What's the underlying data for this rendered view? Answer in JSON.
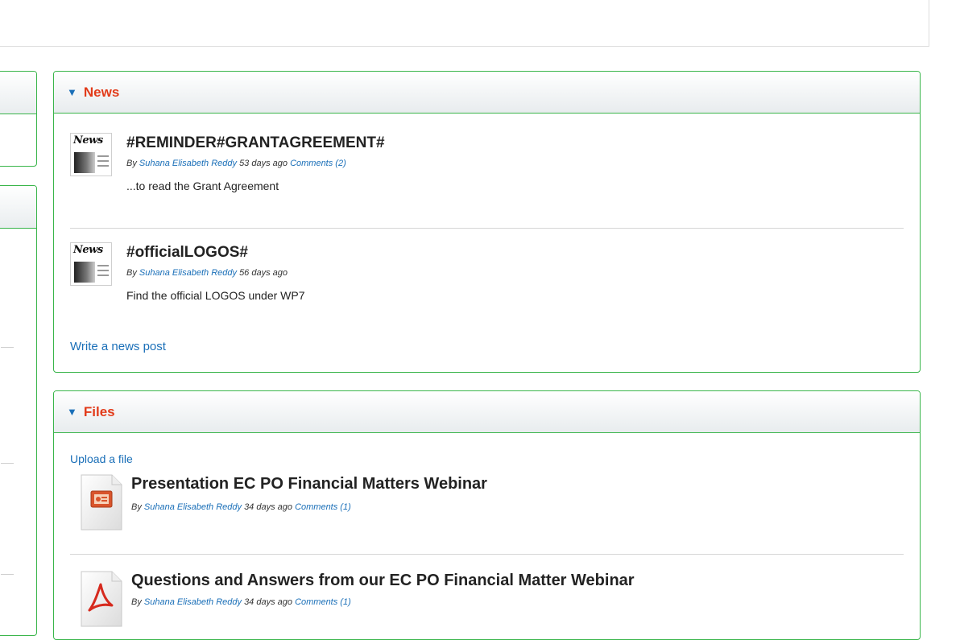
{
  "news": {
    "title": "News",
    "items": [
      {
        "title": "#REMINDER#GRANTAGREEMENT#",
        "by_prefix": "By",
        "author": "Suhana Elisabeth Reddy",
        "age": "53 days ago",
        "comments": "Comments (2)",
        "excerpt": "...to read the Grant Agreement"
      },
      {
        "title": "#officialLOGOS#",
        "by_prefix": "By",
        "author": "Suhana Elisabeth Reddy",
        "age": "56 days ago",
        "comments": "",
        "excerpt": "Find the official LOGOS under WP7"
      }
    ],
    "write_link": "Write a news post"
  },
  "files": {
    "title": "Files",
    "upload_link": "Upload a file",
    "items": [
      {
        "title": "Presentation EC PO Financial Matters Webinar",
        "by_prefix": "By",
        "author": "Suhana Elisabeth Reddy",
        "age": "34 days ago",
        "comments": "Comments (1)",
        "icon": "powerpoint-file-icon"
      },
      {
        "title": "Questions and Answers from our EC PO Financial Matter Webinar",
        "by_prefix": "By",
        "author": "Suhana Elisabeth Reddy",
        "age": "34 days ago",
        "comments": "Comments (1)",
        "icon": "pdf-file-icon"
      }
    ]
  },
  "icons": {
    "news_label": "News"
  },
  "colors": {
    "accent_border": "#39b54a",
    "portlet_title": "#e23b1a",
    "link": "#1a6fb8"
  }
}
